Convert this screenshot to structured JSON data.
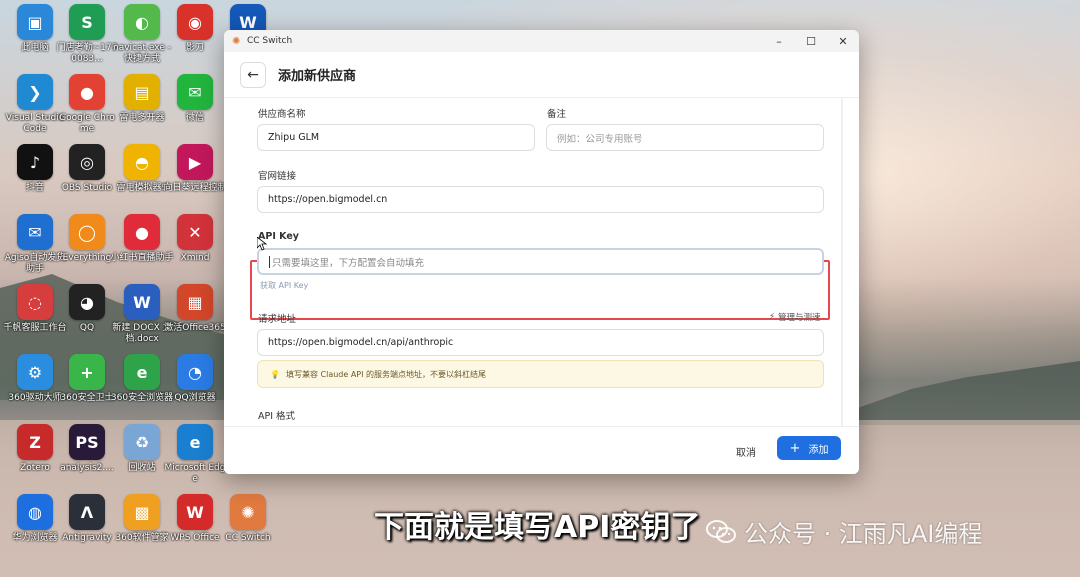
{
  "desktop_icons": [
    {
      "label": "此电脑",
      "glyph": "▣",
      "color": "#2b88d8"
    },
    {
      "label": "门店考勤~1770083...",
      "glyph": "S",
      "color": "#1f9d55"
    },
    {
      "label": "navicat.exe - 快捷方式",
      "glyph": "◐",
      "color": "#53b94a"
    },
    {
      "label": "影刀",
      "glyph": "◉",
      "color": "#d8322b"
    },
    {
      "label": "",
      "glyph": "W",
      "color": "#1458b8"
    },
    {
      "label": "Visual Studio Code",
      "glyph": "❯",
      "color": "#1f8ad2"
    },
    {
      "label": "Google Chrome",
      "glyph": "●",
      "color": "#e34133"
    },
    {
      "label": "雷电多开器",
      "glyph": "▤",
      "color": "#e2b100"
    },
    {
      "label": "微信",
      "glyph": "✉",
      "color": "#21b53d"
    },
    {
      "label": "抖音",
      "glyph": "♪",
      "color": "#111111"
    },
    {
      "label": "OBS Studio",
      "glyph": "◎",
      "color": "#222222"
    },
    {
      "label": "雷电模拟器9",
      "glyph": "◓",
      "color": "#f0b400"
    },
    {
      "label": "向日葵远程控制",
      "glyph": "▶",
      "color": "#c2185b"
    },
    {
      "label": "Agiso自动发货助手",
      "glyph": "✉",
      "color": "#1e6fd0"
    },
    {
      "label": "Everything",
      "glyph": "◯",
      "color": "#f08a1a"
    },
    {
      "label": "小红书直播助手",
      "glyph": "●",
      "color": "#e02b3a"
    },
    {
      "label": "Xmind",
      "glyph": "✕",
      "color": "#d2323a"
    },
    {
      "label": "千帆客服工作台",
      "glyph": "◌",
      "color": "#d63d3d"
    },
    {
      "label": "QQ",
      "glyph": "◕",
      "color": "#222222"
    },
    {
      "label": "新建 DOCX 文档.docx",
      "glyph": "W",
      "color": "#2b5fbf"
    },
    {
      "label": "激活Office365",
      "glyph": "▦",
      "color": "#d2462a"
    },
    {
      "label": "360驱动大师",
      "glyph": "⚙",
      "color": "#2b8de0"
    },
    {
      "label": "360安全卫士",
      "glyph": "+",
      "color": "#3ab54a"
    },
    {
      "label": "360安全浏览器",
      "glyph": "e",
      "color": "#2ea34a"
    },
    {
      "label": "QQ浏览器",
      "glyph": "◔",
      "color": "#2a7be4"
    },
    {
      "label": "Zotero",
      "glyph": "Z",
      "color": "#c62a2a"
    },
    {
      "label": "analysis2....",
      "glyph": "PS",
      "color": "#2a1a3a"
    },
    {
      "label": "回收站",
      "glyph": "♻",
      "color": "#7aa6d6"
    },
    {
      "label": "Microsoft Edge",
      "glyph": "e",
      "color": "#1a7fd0"
    },
    {
      "label": "华为浏览器",
      "glyph": "◍",
      "color": "#1d6fe0"
    },
    {
      "label": "Antigravity",
      "glyph": "Λ",
      "color": "#2b2f3a"
    },
    {
      "label": "360软件管家",
      "glyph": "▩",
      "color": "#f0a020"
    },
    {
      "label": "WPS Office",
      "glyph": "W",
      "color": "#d42a2a"
    },
    {
      "label": "CC Switch",
      "glyph": "✺",
      "color": "#e07a3f"
    }
  ],
  "window": {
    "title": "CC Switch",
    "minimize": "–",
    "maximize": "☐",
    "close": "✕",
    "page_title": "添加新供应商",
    "back_icon": "←"
  },
  "form": {
    "provider_name_label": "供应商名称",
    "provider_name_value": "Zhipu GLM",
    "notes_label": "备注",
    "notes_placeholder": "例如：公司专用账号",
    "website_label": "官网链接",
    "website_value": "https://open.bigmodel.cn",
    "api_key_label": "API Key",
    "api_key_placeholder": "只需要填这里，下方配置会自动填充",
    "get_api_key_link": "获取 API Key",
    "request_url_label": "请求地址",
    "manage_speed_link": "管理与测速",
    "request_url_value": "https://open.bigmodel.cn/api/anthropic",
    "tip_text": "填写兼容 Claude API 的服务端点地址，不要以斜杠结尾",
    "api_format_label": "API 格式"
  },
  "footer": {
    "cancel_label": "取消",
    "add_label": "添加"
  },
  "overlay": {
    "subtitle": "下面就是填写API密钥了",
    "watermark": "公众号 · 江雨凡AI编程"
  },
  "colors": {
    "accent": "#1f6fe0",
    "highlight": "#e5484d"
  }
}
